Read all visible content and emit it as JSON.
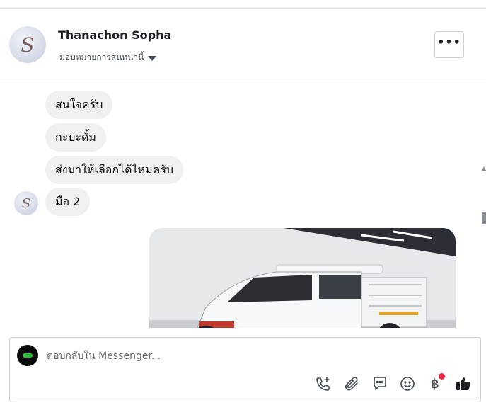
{
  "header": {
    "contact_name": "Thanachon Sopha",
    "assign_label": "มอบหมายการสนทนานี้",
    "more_label": "•••"
  },
  "messages": [
    {
      "text": "สนใจครับ"
    },
    {
      "text": "กะบะดั้ม"
    },
    {
      "text": "ส่งมาให้เลือกได้ไหมครับ"
    },
    {
      "text": "มือ 2"
    }
  ],
  "composer": {
    "placeholder": "ตอบกลับใน Messenger..."
  },
  "toolbar": {
    "icons": [
      "phone-plus-icon",
      "paperclip-icon",
      "chat-bubble-icon",
      "smiley-icon",
      "baht-icon",
      "thumbs-up-icon"
    ],
    "baht_symbol": "฿"
  },
  "colors": {
    "bubble": "#f0f0f0",
    "badge": "#f02849",
    "border": "#ccd0d5"
  }
}
